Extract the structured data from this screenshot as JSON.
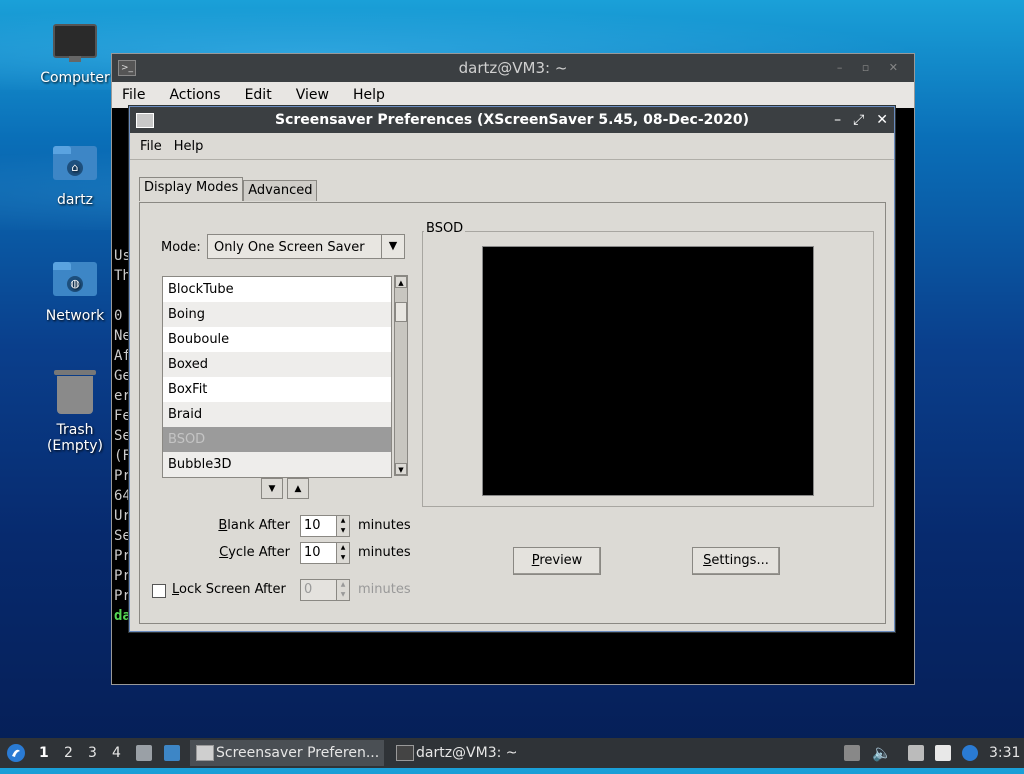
{
  "desktop": {
    "icons": [
      {
        "label": "Computer",
        "icon": "computer-icon"
      },
      {
        "label": "dartz",
        "icon": "home-folder-icon"
      },
      {
        "label": "Network",
        "icon": "network-folder-icon"
      },
      {
        "label": "Trash (Empty)",
        "icon": "trash-icon"
      }
    ]
  },
  "terminal": {
    "title": "dartz@VM3: ~",
    "menu": [
      "File",
      "Actions",
      "Edit",
      "View",
      "Help"
    ],
    "visible_lines": [
      "Us",
      "Th",
      "",
      "0",
      "Ne",
      "Af",
      "Ge",
      "er",
      "Fe",
      "Se",
      "(F",
      "Pr",
      "64",
      "Ur",
      "Se",
      "Pr",
      "Pr",
      "Pr"
    ],
    "prompt_fragment": "da"
  },
  "dialog": {
    "title": "Screensaver Preferences  (XScreenSaver 5.45, 08-Dec-2020)",
    "menu": {
      "file": "File",
      "help": "Help"
    },
    "tabs": {
      "display_modes": "Display Modes",
      "advanced": "Advanced"
    },
    "mode": {
      "label": "Mode:",
      "value": "Only One Screen Saver"
    },
    "savers": [
      "BlockTube",
      "Boing",
      "Bouboule",
      "Boxed",
      "BoxFit",
      "Braid",
      "BSOD",
      "Bubble3D"
    ],
    "selected_saver": "BSOD",
    "preview_frame_label": "BSOD",
    "blank_after": {
      "label": "Blank After",
      "value": "10",
      "unit": "minutes"
    },
    "cycle_after": {
      "label": "Cycle After",
      "value": "10",
      "unit": "minutes"
    },
    "lock_after": {
      "label": "Lock Screen After",
      "value": "0",
      "unit": "minutes",
      "checked": false
    },
    "buttons": {
      "preview": "Preview",
      "settings": "Settings..."
    }
  },
  "taskbar": {
    "workspaces": [
      "1",
      "2",
      "3",
      "4"
    ],
    "active_workspace": "1",
    "tasks": [
      {
        "label": "Screensaver Preferen...",
        "active": true
      },
      {
        "label": "dartz@VM3: ~",
        "active": false
      }
    ],
    "clock": "3:31"
  }
}
